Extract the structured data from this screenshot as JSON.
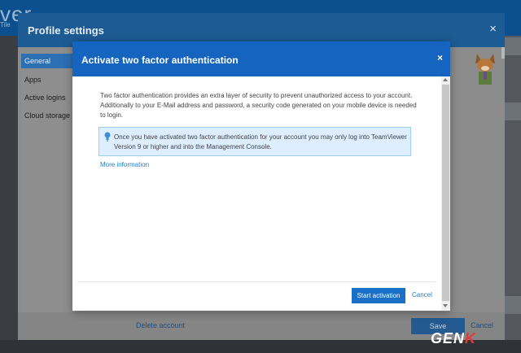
{
  "app": {
    "logo_text": "ver",
    "logo_sub": "Tile"
  },
  "profile": {
    "title": "Profile settings",
    "close_glyph": "×",
    "sidebar": [
      {
        "label": "General"
      },
      {
        "label": "Apps"
      },
      {
        "label": "Active logins"
      },
      {
        "label": "Cloud storage"
      }
    ],
    "delete_account": "Delete account",
    "save": "Save",
    "cancel": "Cancel"
  },
  "modal": {
    "title": "Activate two factor authentication",
    "close_glyph": "×",
    "intro": "Two factor authentication provides an extra layer of security to prevent unauthorized access to your account. Additionally to your E-Mail address and password, a security code generated on your mobile device is needed to login.",
    "info": "Once you have activated two factor authentication for your account you may only log into TeamViewer Version 9 or higher and into the Management Console.",
    "more_info": "More information",
    "start_activation": "Start activation",
    "cancel": "Cancel"
  },
  "watermark": {
    "text_main": "GEN",
    "text_accent": "K"
  },
  "icons": {
    "info": "lightbulb-icon",
    "close": "close-icon",
    "avatar": "fox-avatar-icon"
  },
  "colors": {
    "modal_header": "#1564c0",
    "primary_button": "#1a6fc7",
    "link": "#1f7fcf",
    "info_bg": "#dceeff"
  }
}
